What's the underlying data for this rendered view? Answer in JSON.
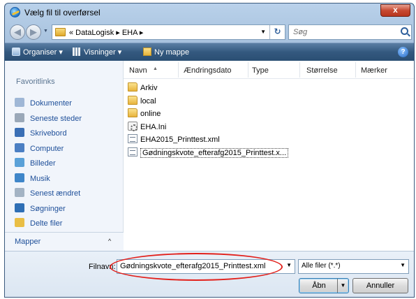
{
  "window": {
    "title": "Vælg fil til overførsel",
    "close_label": "x"
  },
  "address": {
    "crumbs": "« DataLogisk ▸ EHA ▸",
    "search_placeholder": "Søg"
  },
  "toolbar": {
    "organize": "Organiser ▾",
    "views": "Visninger ▾",
    "new_folder": "Ny mappe",
    "help": "?"
  },
  "nav_pane": {
    "favorites_header": "Favoritlinks",
    "items": [
      {
        "label": "Dokumenter",
        "icon": "documents-icon",
        "color": "#9fb7d6"
      },
      {
        "label": "Seneste steder",
        "icon": "recent-places-icon",
        "color": "#9aa8b8"
      },
      {
        "label": "Skrivebord",
        "icon": "desktop-icon",
        "color": "#3a6fb5"
      },
      {
        "label": "Computer",
        "icon": "computer-icon",
        "color": "#4b7fc3"
      },
      {
        "label": "Billeder",
        "icon": "pictures-icon",
        "color": "#5aa1d8"
      },
      {
        "label": "Musik",
        "icon": "music-icon",
        "color": "#3f86c9"
      },
      {
        "label": "Senest ændret",
        "icon": "recently-changed-icon",
        "color": "#a3b3c4"
      },
      {
        "label": "Søgninger",
        "icon": "searches-icon",
        "color": "#2f6fb5"
      },
      {
        "label": "Delte filer",
        "icon": "shared-files-icon",
        "color": "#e9be45"
      }
    ],
    "folders_label": "Mapper",
    "folders_caret": "^"
  },
  "columns": {
    "name": "Navn",
    "modified": "Ændringsdato",
    "type": "Type",
    "size": "Størrelse",
    "tags": "Mærker"
  },
  "files": [
    {
      "name": "Arkiv",
      "kind": "folder"
    },
    {
      "name": "local",
      "kind": "folder"
    },
    {
      "name": "online",
      "kind": "folder"
    },
    {
      "name": "EHA.Ini",
      "kind": "ini"
    },
    {
      "name": "EHA2015_Printtest.xml",
      "kind": "xml"
    },
    {
      "name": "Gødningskvote_efterafg2015_Printtest.x...",
      "kind": "xml",
      "selected": true
    }
  ],
  "bottom": {
    "filename_label": "Filnavn:",
    "filename_value": "Gødningskvote_efterafg2015_Printtest.xml",
    "filter_value": "Alle filer (*.*)",
    "open_label": "Åbn",
    "cancel_label": "Annuller"
  }
}
